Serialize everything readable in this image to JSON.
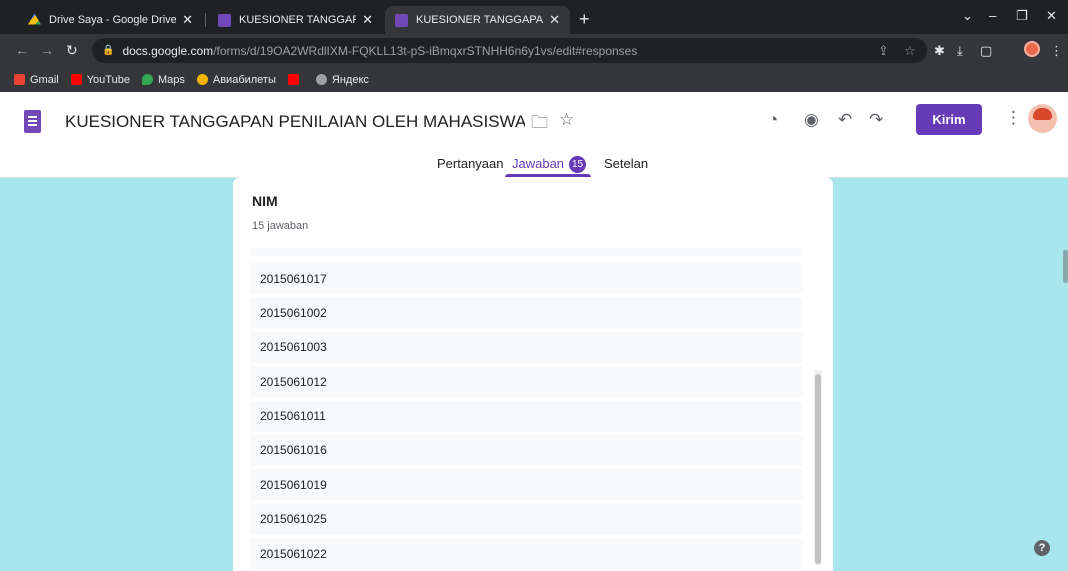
{
  "browser": {
    "tabs": [
      {
        "title": "Drive Saya - Google Drive",
        "icon": "google-drive-icon"
      },
      {
        "title": "KUESIONER TANGGAPAN PENILA",
        "icon": "google-forms-icon"
      },
      {
        "title": "KUESIONER TANGGAPAN PENILA",
        "icon": "google-forms-icon"
      }
    ],
    "url_host": "docs.google.com",
    "url_path": "/forms/d/19OA2WRdlIXM-FQKLL13t-pS-iBmqxrSTNHH6n6y1vs/edit#responses",
    "bookmarks": [
      {
        "label": "Gmail",
        "color": "#ea4335"
      },
      {
        "label": "YouTube",
        "color": "#ff0000"
      },
      {
        "label": "Maps",
        "color": "#34a853"
      },
      {
        "label": "Авиабилеты",
        "color": "#f4b400"
      },
      {
        "label": "",
        "color": "#ff0000"
      },
      {
        "label": "Яндекс",
        "color": "#9aa0a6"
      }
    ]
  },
  "form": {
    "title": "KUESIONER TANGGAPAN PENILAIAN OLEH MAHASISWA (UJI KELOMPOK",
    "send_label": "Kirim",
    "tabs": {
      "questions": "Pertanyaan",
      "responses": "Jawaban",
      "responses_count": "15",
      "settings": "Setelan"
    },
    "accent": "#673ab7",
    "background": "#a8e6ee"
  },
  "question": {
    "title": "NIM",
    "count_label": "15 jawaban",
    "responses": [
      "2015061017",
      "2015061002",
      "2015061003",
      "2015061012",
      "2015061011",
      "2015061016",
      "2015061019",
      "2015061025",
      "2015061022"
    ]
  }
}
